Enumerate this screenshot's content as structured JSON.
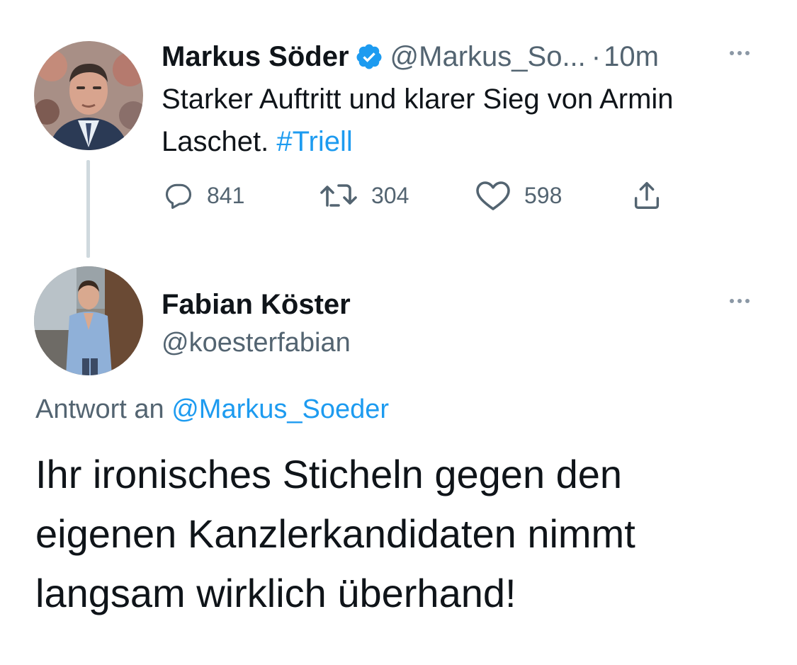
{
  "tweet1": {
    "display_name": "Markus Söder",
    "handle": "@Markus_So...",
    "separator": "·",
    "time": "10m",
    "text": "Starker Auftritt und klarer Sieg von Armin Laschet.",
    "hashtag": "#Triell",
    "actions": {
      "replies": "841",
      "retweets": "304",
      "likes": "598"
    }
  },
  "tweet2": {
    "display_name": "Fabian Köster",
    "handle": "@koesterfabian",
    "reply_prefix": "Antwort an",
    "reply_mention": "@Markus_Soeder",
    "text": "Ihr ironisches Sticheln gegen den eigenen Kanzlerkandidaten nimmt langsam wirklich überhand!"
  },
  "icons": {
    "verified": "verified-badge-icon",
    "more": "more-options-icon",
    "reply": "reply-icon",
    "retweet": "retweet-icon",
    "like": "heart-icon",
    "share": "share-icon"
  },
  "colors": {
    "accent": "#1d9bf0",
    "text": "#0f1419",
    "secondary": "#536471",
    "thread_line": "#cfd9de"
  }
}
